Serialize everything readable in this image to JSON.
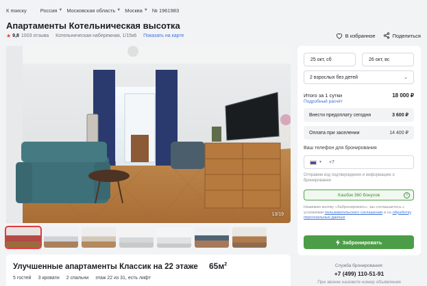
{
  "breadcrumb": {
    "back": "К поиску",
    "country": "Россия",
    "region": "Московская область",
    "city": "Москва",
    "listing_id": "№ 1961983"
  },
  "listing": {
    "title": "Апартаменты Котельническая высотка",
    "rating": "9,8",
    "reviews": "1003 отзыва",
    "address": "Котельническая набережная, 1/15к6",
    "map_link": "Показать на карте",
    "favorite_label": "В избранное",
    "share_label": "Поделиться",
    "photo_counter": "13/19"
  },
  "room": {
    "title": "Улучшенные апартаменты Классик на 22 этаже",
    "area": "65м",
    "area_sup": "2",
    "guests": "5 гостей",
    "beds": "3 кровати",
    "bedrooms": "2 спальни",
    "floor": "этаж 22 из 31, есть лифт"
  },
  "booking": {
    "checkin": "25 окт, сб",
    "checkout": "26 окт, вс",
    "guests": "2 взрослых без детей",
    "total_label": "Итого за 1 сутки",
    "total_amount": "18 000 ₽",
    "calc_link": "Подробный расчёт",
    "prepay_label": "Внести предоплату сегодня",
    "prepay_amount": "3 600 ₽",
    "checkin_pay_label": "Оплата при заселении",
    "checkin_pay_amount": "14 400 ₽",
    "phone_label": "Ваш телефон для бронирования",
    "phone_placeholder": "+7",
    "hint": "Отправим код подтверждения и информацию о бронировании",
    "cashback": "Кэшбэк 360 бонусов",
    "legal_prefix": "Нажимая кнопку «Забронировать», вы соглашаетесь с условиями ",
    "legal_link1": "пользовательского соглашения",
    "legal_mid": " и на ",
    "legal_link2": "обработку персональных данных",
    "book_button": "Забронировать"
  },
  "support": {
    "label": "Служба бронирования:",
    "phone": "+7 (499) 110-51-91",
    "hint": "При звонке назовите номер объявления"
  },
  "colors": {
    "accent_red": "#e23b3b",
    "link_blue": "#3c72d8",
    "book_green": "#4c9d47"
  }
}
